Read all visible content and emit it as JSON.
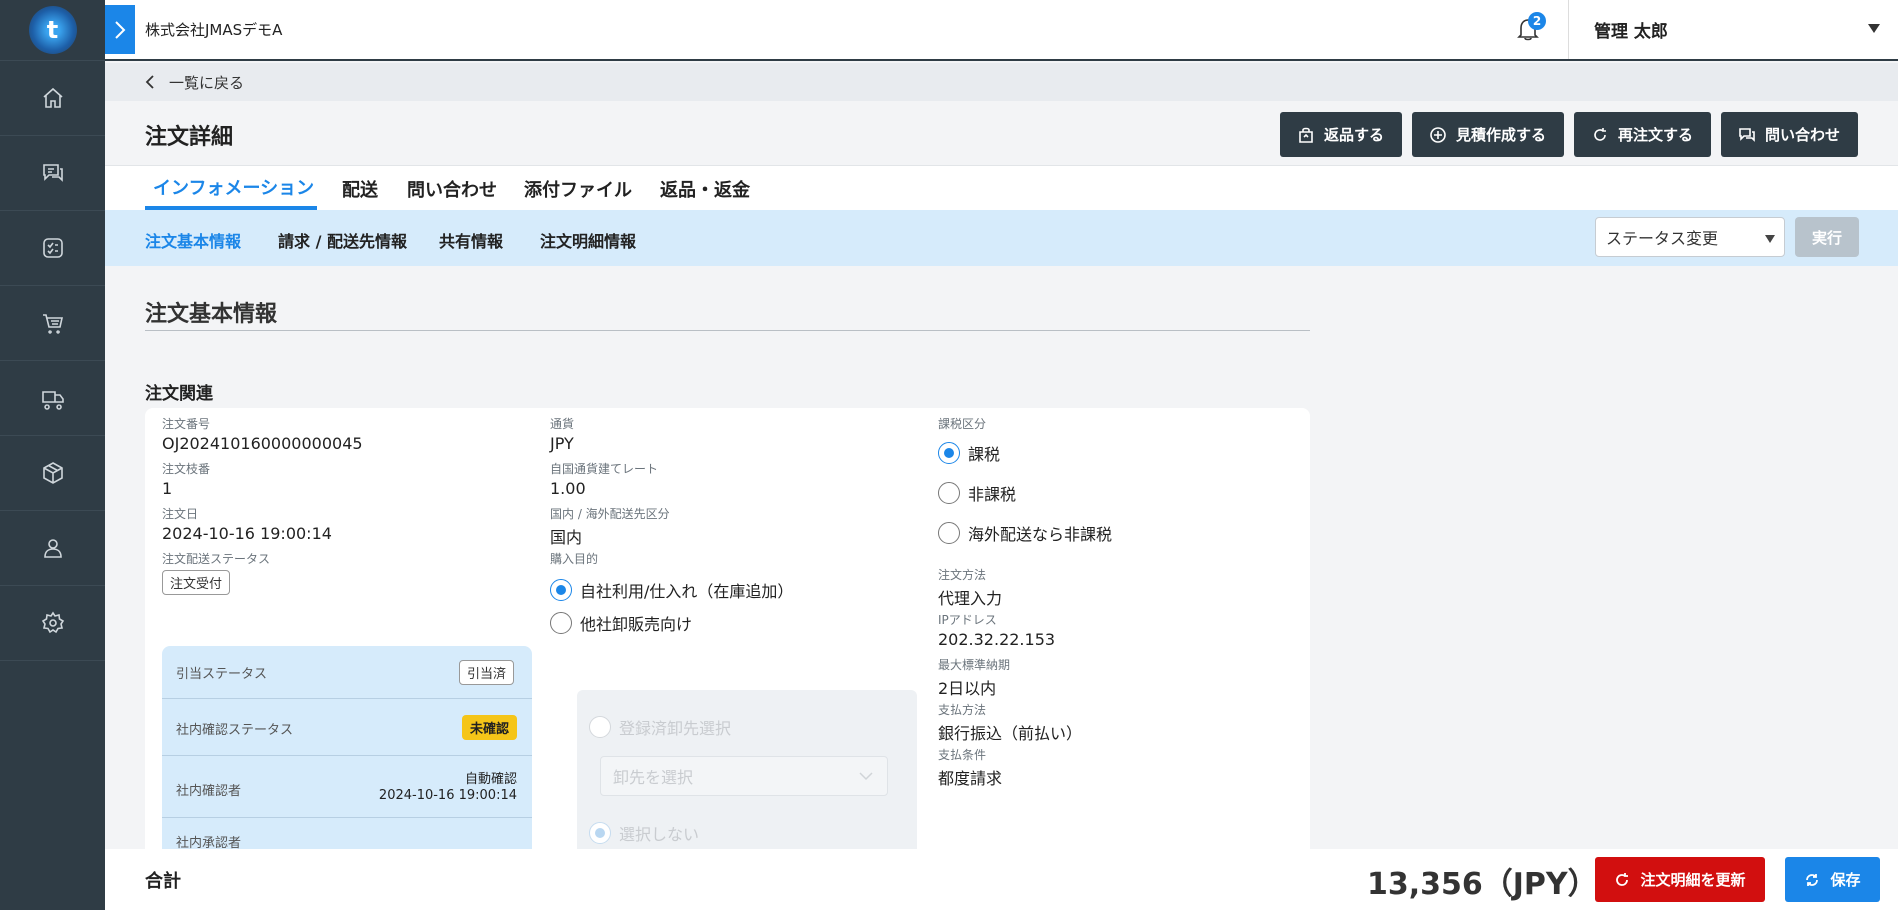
{
  "sidebar": {
    "logo_text": "t",
    "items": [
      {
        "icon": "home-icon"
      },
      {
        "icon": "chat-icon"
      },
      {
        "icon": "checklist-icon"
      },
      {
        "icon": "cart-icon"
      },
      {
        "icon": "truck-icon"
      },
      {
        "icon": "box-icon"
      },
      {
        "icon": "user-icon"
      },
      {
        "icon": "gear-icon"
      }
    ]
  },
  "topbar": {
    "company": "株式会社JMASデモA",
    "notification_count": "2",
    "user_name": "管理 太郎"
  },
  "back_link": "一覧に戻る",
  "page_title": "注文詳細",
  "actions": {
    "return": "返品する",
    "estimate": "見積作成する",
    "reorder": "再注文する",
    "inquiry": "問い合わせ"
  },
  "tabs": [
    "インフォメーション",
    "配送",
    "問い合わせ",
    "添付ファイル",
    "返品・返金"
  ],
  "subtabs": [
    "注文基本情報",
    "請求 / 配送先情報",
    "共有情報",
    "注文明細情報"
  ],
  "status_select": "ステータス変更",
  "exec_button": "実行",
  "section_title": "注文基本情報",
  "group_title": "注文関連",
  "col1": {
    "order_no_label": "注文番号",
    "order_no": "OJ202410160000000045",
    "branch_label": "注文枝番",
    "branch": "1",
    "date_label": "注文日",
    "date": "2024-10-16 19:00:14",
    "ship_status_label": "注文配送ステータス",
    "ship_status": "注文受付",
    "panel": {
      "alloc_label": "引当ステータス",
      "alloc_value": "引当済",
      "confirm_label": "社内確認ステータス",
      "confirm_value": "未確認",
      "confirmer_label": "社内確認者",
      "confirmer_value": "自動確認",
      "confirmer_date": "2024-10-16 19:00:14",
      "approver_label": "社内承認者"
    }
  },
  "col2": {
    "currency_label": "通貨",
    "currency": "JPY",
    "rate_label": "自国通貨建てレート",
    "rate": "1.00",
    "domestic_label": "国内 / 海外配送先区分",
    "domestic": "国内",
    "purpose_label": "購入目的",
    "purpose_options": [
      "自社利用/仕入れ（在庫追加）",
      "他社卸販売向け"
    ],
    "wholesale_options": [
      "登録済卸先選択",
      "選択しない"
    ],
    "wholesale_placeholder": "卸先を選択"
  },
  "col3": {
    "tax_label": "課税区分",
    "tax_options": [
      "課税",
      "非課税",
      "海外配送なら非課税"
    ],
    "method_label": "注文方法",
    "method": "代理入力",
    "ip_label": "IPアドレス",
    "ip": "202.32.22.153",
    "delivery_label": "最大標準納期",
    "delivery": "2日以内",
    "payment_label": "支払方法",
    "payment": "銀行振込（前払い）",
    "terms_label": "支払条件",
    "terms": "都度請求"
  },
  "footer": {
    "total_label": "合計",
    "total_value": "13,356（JPY）",
    "update_button": "注文明細を更新",
    "save_button": "保存"
  },
  "colors": {
    "accent": "#1b86e8",
    "sidebar": "#2f3c45",
    "danger": "#d20f0f",
    "warning": "#f5c518"
  }
}
